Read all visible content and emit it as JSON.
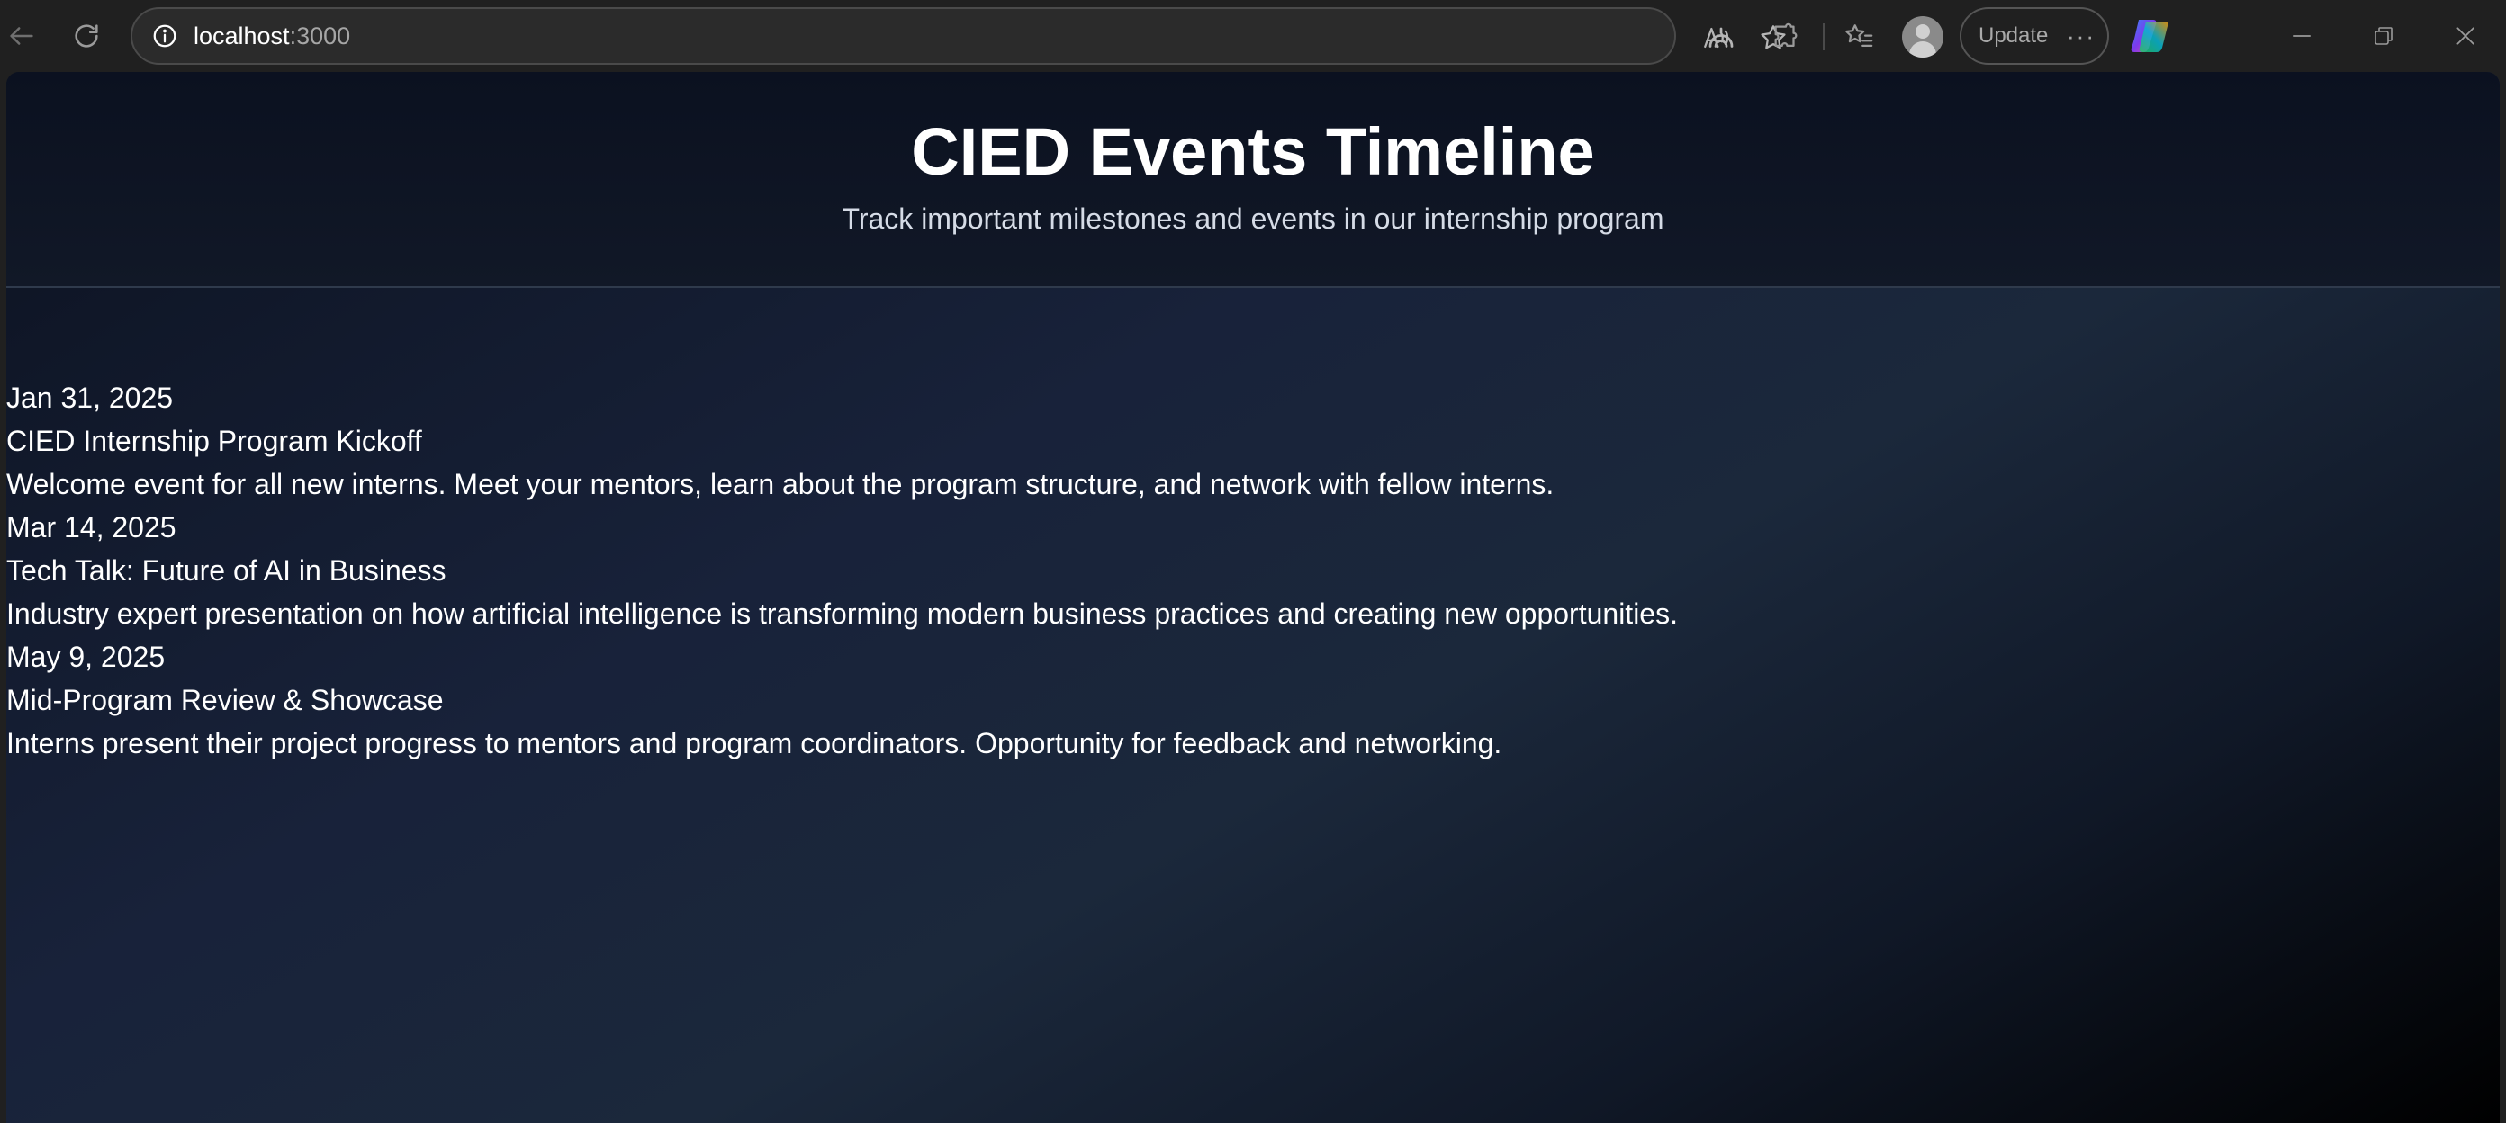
{
  "browser": {
    "address": {
      "host": "localhost",
      "port": ":3000"
    },
    "update_label": "Update",
    "more_label": "···"
  },
  "page": {
    "title": "CIED Events Timeline",
    "subtitle": "Track important milestones and events in our internship program"
  },
  "events": [
    {
      "date": "Jan 31, 2025",
      "title": "CIED Internship Program Kickoff",
      "description": "Welcome event for all new interns. Meet your mentors, learn about the program structure, and network with fellow interns."
    },
    {
      "date": "Mar 14, 2025",
      "title": "Tech Talk: Future of AI in Business",
      "description": "Industry expert presentation on how artificial intelligence is transforming modern business practices and creating new opportunities."
    },
    {
      "date": "May 9, 2025",
      "title": "Mid-Program Review & Showcase",
      "description": "Interns present their project progress to mentors and program coordinators. Opportunity for feedback and networking."
    }
  ]
}
